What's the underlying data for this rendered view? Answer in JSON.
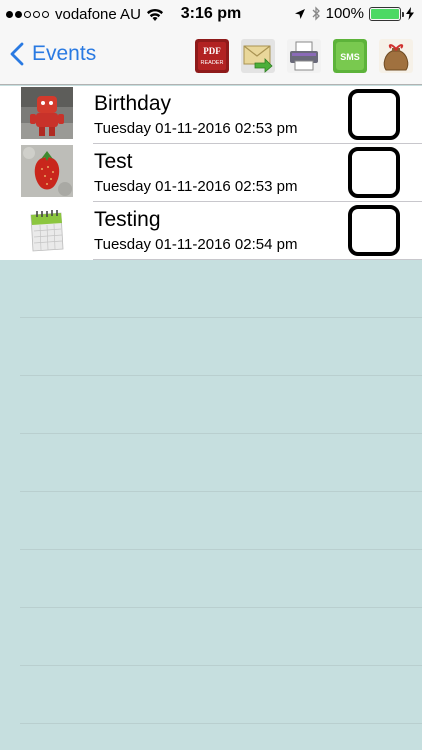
{
  "status_bar": {
    "signal_dots_filled": 2,
    "signal_dots_total": 5,
    "carrier": "vodafone AU",
    "time": "3:16 pm",
    "battery": "100%",
    "battery_level": 1.0,
    "battery_color": "#4cd964"
  },
  "nav": {
    "back_label": "Events",
    "accent_color": "#2a7ae2",
    "toolbar_icons": [
      "pdf-reader-icon",
      "email-icon",
      "printer-icon",
      "sms-icon",
      "gift-sack-icon"
    ],
    "pdf_text_1": "PDF",
    "pdf_text_2": "READER",
    "sms_text": "SMS"
  },
  "events": [
    {
      "title": "Birthday",
      "subtitle": "Tuesday 01-11-2016 02:53 pm",
      "thumbnail": "red-robot-toy-photo",
      "checked": false
    },
    {
      "title": "Test",
      "subtitle": "Tuesday 01-11-2016 02:53 pm",
      "thumbnail": "strawberry-photo",
      "checked": false
    },
    {
      "title": "Testing",
      "subtitle": "Tuesday 01-11-2016 02:54 pm",
      "thumbnail": "calendar-icon",
      "checked": false
    }
  ],
  "colors": {
    "background": "#c6dfdf",
    "bar_background": "#f7f7f7"
  }
}
